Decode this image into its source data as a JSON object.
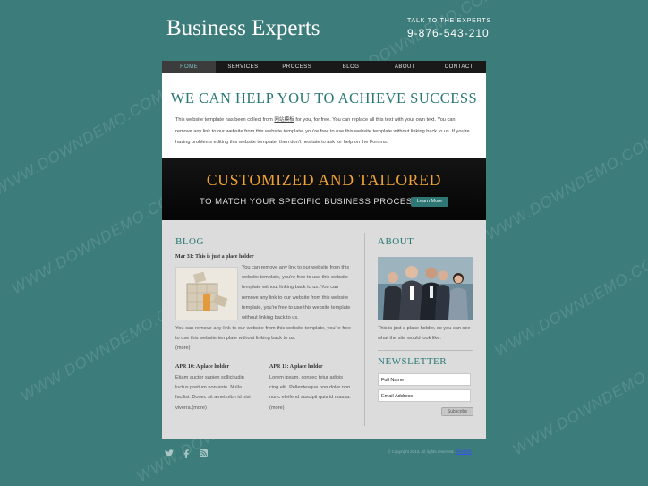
{
  "header": {
    "logo": "Business Experts",
    "talk_label": "TALK TO THE EXPERTS",
    "phone": "9-876-543-210"
  },
  "nav": {
    "items": [
      {
        "label": "HOME",
        "active": true
      },
      {
        "label": "SERVICES",
        "active": false
      },
      {
        "label": "PROCESS",
        "active": false
      },
      {
        "label": "BLOG",
        "active": false
      },
      {
        "label": "ABOUT",
        "active": false
      },
      {
        "label": "CONTACT",
        "active": false
      }
    ]
  },
  "intro": {
    "title": "WE CAN HELP YOU TO ACHIEVE SUCCESS",
    "text_before_link": "This website template has been collect from ",
    "link": "网站模板",
    "text_after_link": " for you, for free. You can replace all this text with your own text. You can remove any link to our website from this website template, you're free to use this website template without linking back to us. If you're having problems editing this website template, then don't hesitate to ask for help on the Forums."
  },
  "banner": {
    "title": "CUSTOMIZED AND TAILORED",
    "subtitle": "TO MATCH YOUR SPECIFIC BUSINESS PROCESS",
    "button": "Learn More"
  },
  "blog": {
    "title": "BLOG",
    "post_title": "Mar 31: This is just a place holder",
    "post_text_side": "You can remove any link to our website from this website template, you're free to use this website template without linking back to us. You can remove any link to our website from this website template, you're free to use this website template without linking back to us.",
    "post_text_bottom": "You can remove any link to our website from this website template, you're free to use this website template without linking back to us.",
    "post_more": "(more)",
    "posts": [
      {
        "title": "APR 10: A place holder",
        "text": "Etiam auctor sapien sollicitudin luctus pretium non ante. Nulla facilisi. Donec sit amet nibh id nisi viverra.",
        "more": "(more)"
      },
      {
        "title": "APR 11: A place holder",
        "text": "Lorem ipsum, consec tetur adipis cing elit. Pellentesque non dolor non nunc eleifend suscipit quis id massa.",
        "more": "(more)"
      }
    ]
  },
  "about": {
    "title": "ABOUT",
    "text": "This is just a place holder, so you can see what the site would look like."
  },
  "newsletter": {
    "title": "NEWSLETTER",
    "name_placeholder": "Full Name",
    "email_placeholder": "Email Address",
    "button": "Subscribe"
  },
  "footer": {
    "social_icons": [
      "twitter-icon",
      "facebook-icon",
      "rss-icon"
    ],
    "copyright": "© Copyright 2013. All rights reserved.",
    "copyright_link": "网站模板"
  },
  "watermark": "WWW.DOWNDEMO.COM",
  "colors": {
    "background": "#3c7c7a",
    "accent": "#2a7977",
    "banner_title": "#f0a234",
    "nav_bg": "#191919"
  }
}
